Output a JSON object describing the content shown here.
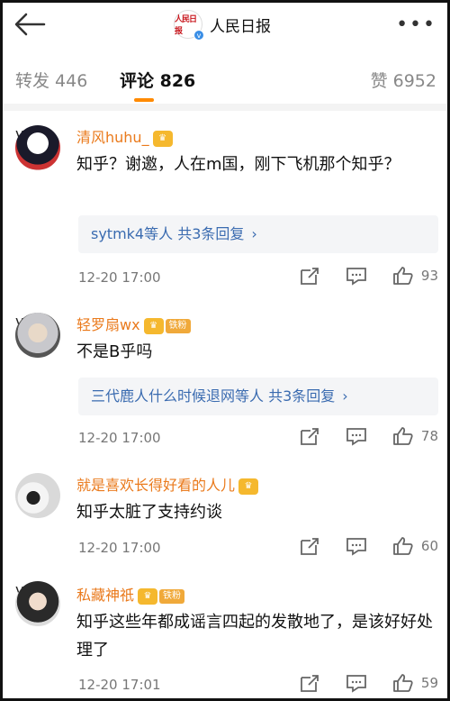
{
  "header": {
    "title": "人民日报",
    "logo_text": "人民日报",
    "verified_mark": "v"
  },
  "tabs": {
    "repost": "转发 446",
    "comment": "评论 826",
    "like": "赞 6952"
  },
  "comments": [
    {
      "username": "清风huhu_",
      "text": "知乎？谢邀，人在m国，刚下飞机那个知乎？",
      "reply_summary": "sytmk4等人  共3条回复",
      "time": "12-20 17:00",
      "likes": "93"
    },
    {
      "username": "轻罗扇wx",
      "fan_badge": "铁粉",
      "text": "不是B乎吗",
      "reply_summary": "三代鹿人什么时候退网等人  共3条回复",
      "time": "12-20 17:00",
      "likes": "78"
    },
    {
      "username": "就是喜欢长得好看的人儿",
      "text": "知乎太脏了支持约谈",
      "time": "12-20 17:00",
      "likes": "60"
    },
    {
      "username": "私藏神祇",
      "fan_badge": "铁粉",
      "text": "知乎这些年都成谣言四起的发散地了，是该好好处理了",
      "time": "12-20 17:01",
      "likes": "59"
    }
  ],
  "icons": {
    "back": "back-arrow-icon",
    "more": "more-dots-icon",
    "share": "share-icon",
    "reply": "comment-icon",
    "like": "thumbs-up-icon"
  },
  "colors": {
    "accent": "#ff8a00",
    "username": "#ea7a1c",
    "link": "#3a6bb0"
  }
}
